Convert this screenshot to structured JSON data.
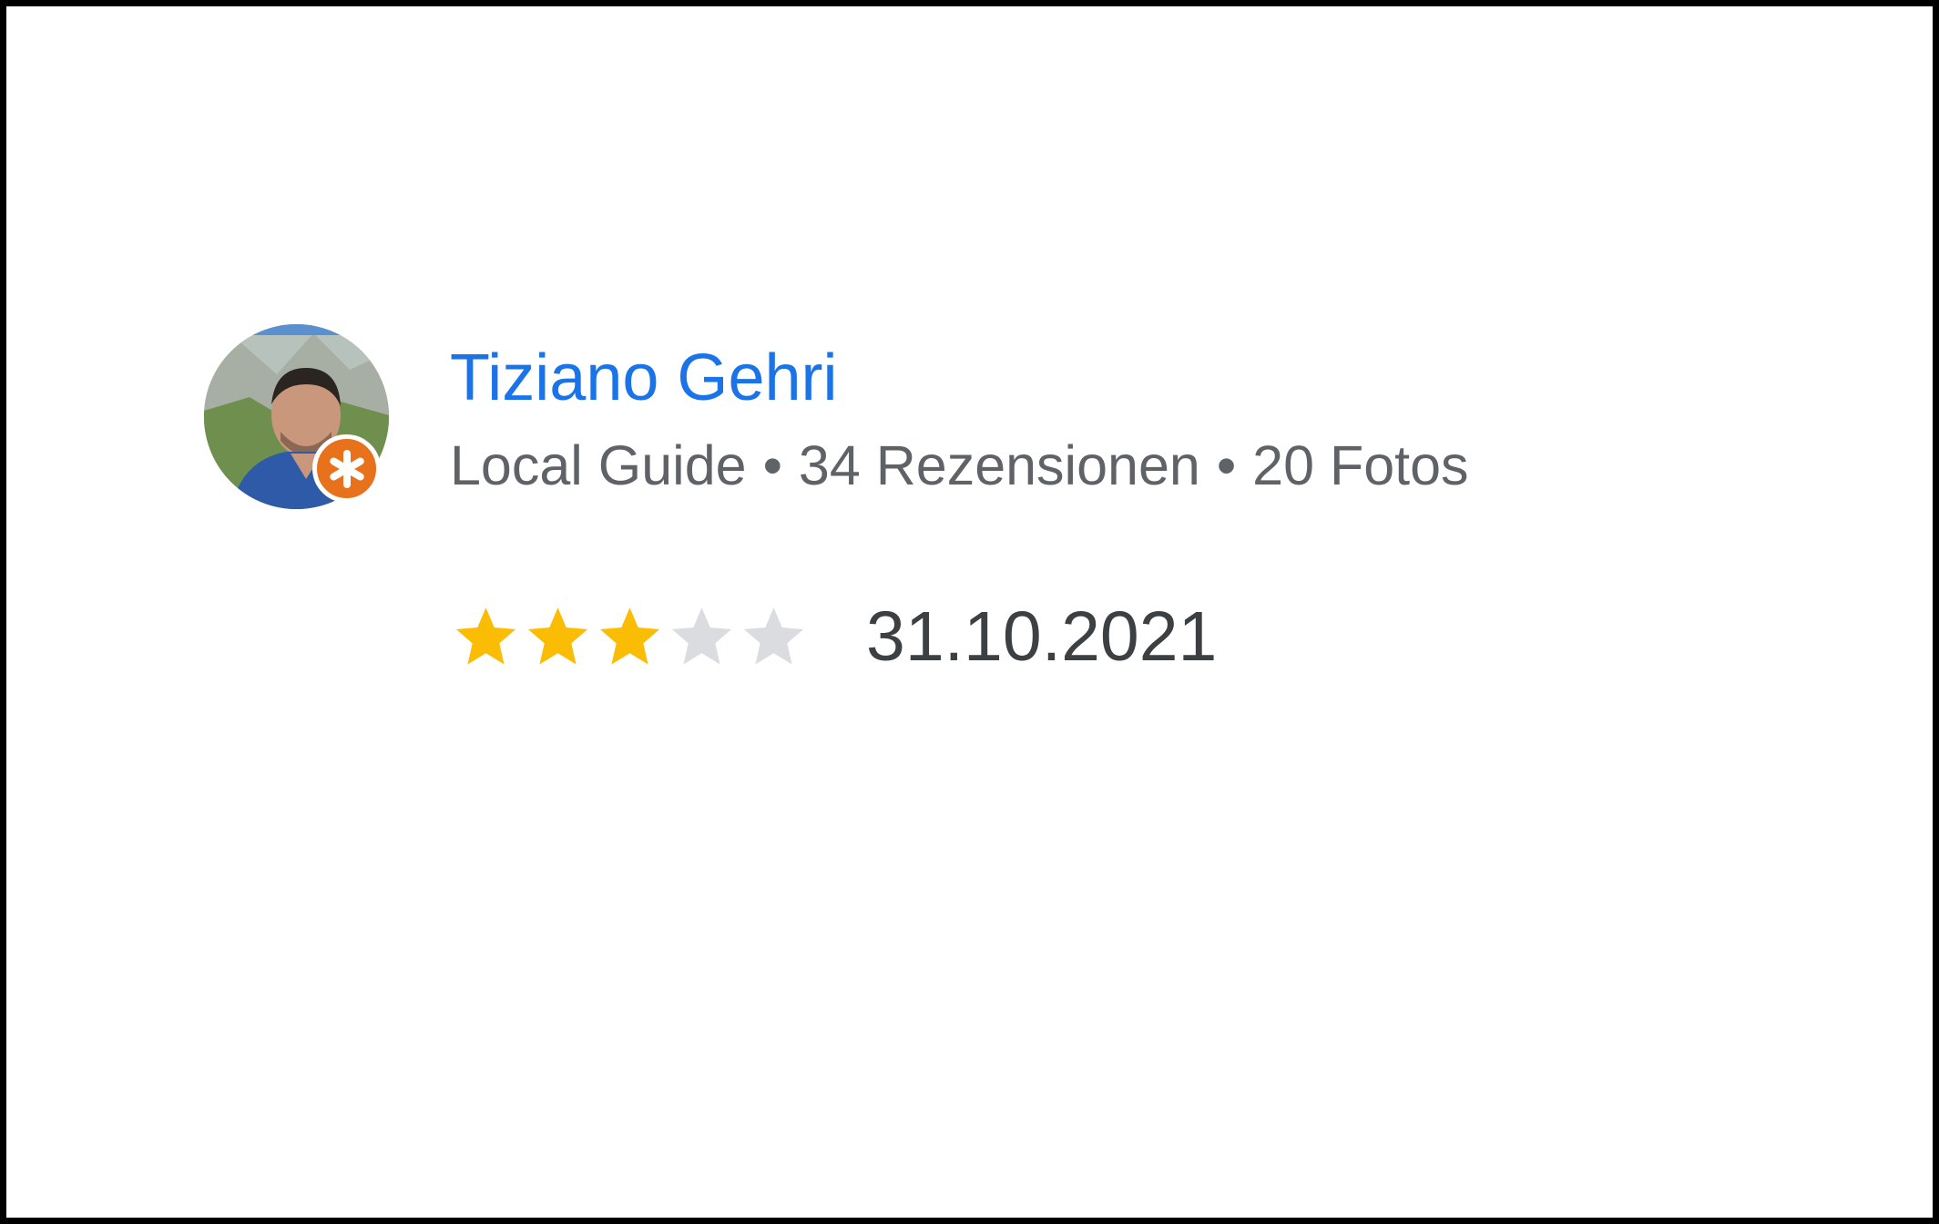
{
  "review": {
    "reviewer_name": "Tiziano Gehri",
    "badge_label": "Local Guide",
    "separator": "•",
    "review_count_text": "34 Rezensionen",
    "photo_count_text": "20 Fotos",
    "rating": 3,
    "rating_max": 5,
    "date": "31.10.2021"
  },
  "colors": {
    "name": "#1a73e8",
    "meta_text": "#5f6368",
    "star_filled": "#fbbc04",
    "star_empty": "#dadce0",
    "guide_badge": "#e8711c"
  },
  "icons": {
    "avatar": "profile-photo",
    "badge": "local-guide-badge-icon",
    "star": "star-icon"
  }
}
